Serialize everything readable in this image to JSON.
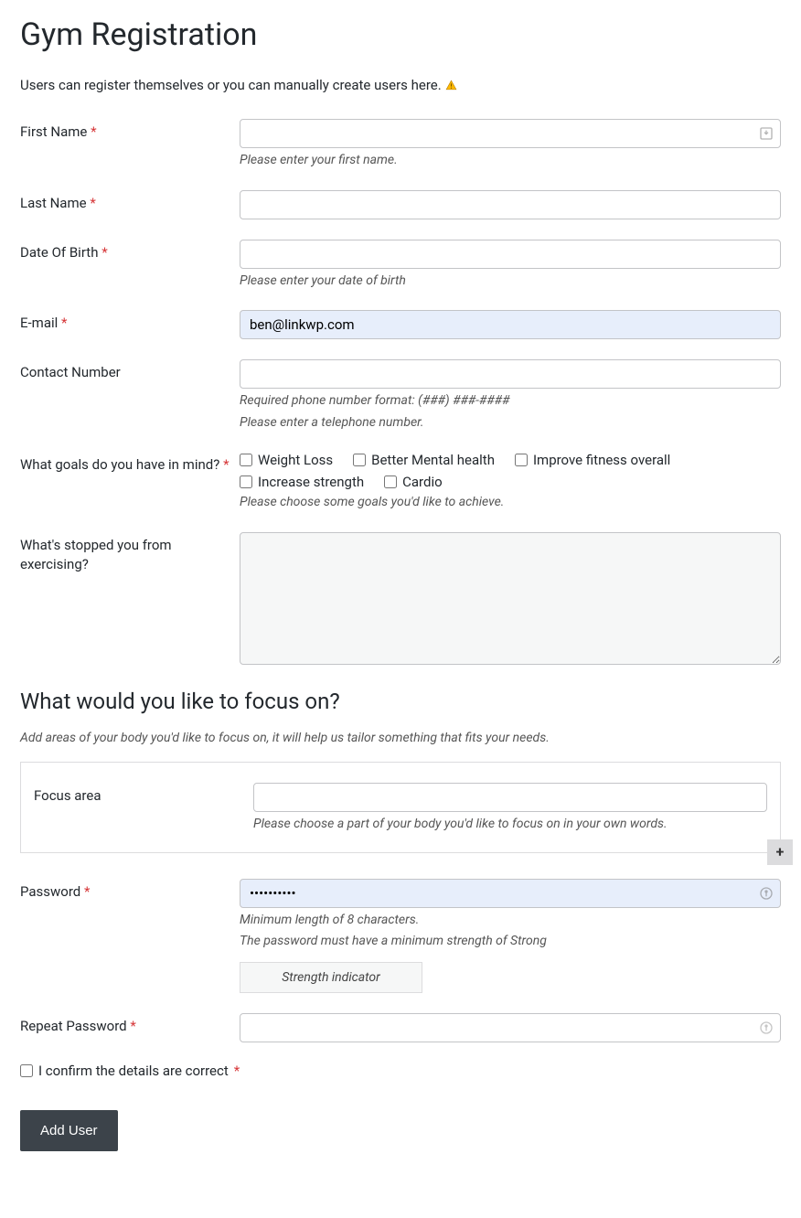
{
  "title": "Gym Registration",
  "intro": "Users can register themselves or you can manually create users here.",
  "fields": {
    "first_name": {
      "label": "First Name",
      "hint": "Please enter your first name."
    },
    "last_name": {
      "label": "Last Name"
    },
    "dob": {
      "label": "Date Of Birth",
      "hint": "Please enter your date of birth"
    },
    "email": {
      "label": "E-mail",
      "value": "ben@linkwp.com"
    },
    "contact": {
      "label": "Contact Number",
      "hint1": "Required phone number format: (###) ###-####",
      "hint2": "Please enter a telephone number."
    },
    "goals": {
      "label": "What goals do you have in mind?",
      "options": [
        "Weight Loss",
        "Better Mental health",
        "Improve fitness overall",
        "Increase strength",
        "Cardio"
      ],
      "hint": "Please choose some goals you'd like to achieve."
    },
    "stopped": {
      "label": "What's stopped you from exercising?"
    }
  },
  "focus_section": {
    "heading": "What would you like to focus on?",
    "hint": "Add areas of your body you'd like to focus on, it will help us tailor something that fits your needs.",
    "field_label": "Focus area",
    "field_hint": "Please choose a part of your body you'd like to focus on in your own words.",
    "add_label": "+"
  },
  "password": {
    "label": "Password",
    "value": "••••••••••",
    "hint1": "Minimum length of 8 characters.",
    "hint2": "The password must have a minimum strength of Strong",
    "strength": "Strength indicator"
  },
  "repeat_password": {
    "label": "Repeat Password"
  },
  "confirm": {
    "label": "I confirm the details are correct"
  },
  "submit": "Add User"
}
